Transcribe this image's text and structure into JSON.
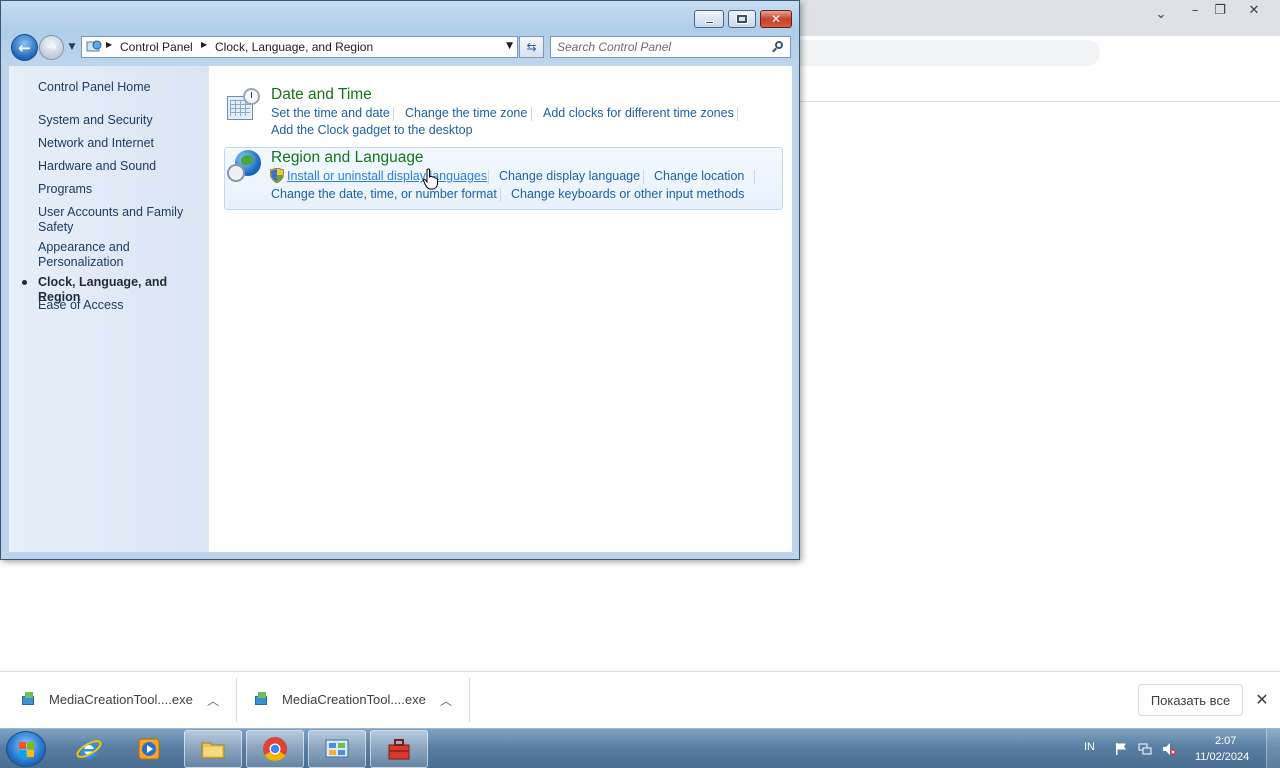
{
  "browser": {
    "toolbar_icons": [
      "share-icon",
      "star-icon",
      "side-panel-icon",
      "profile-icon",
      "menu-icon"
    ]
  },
  "window": {
    "title": "",
    "controls": {
      "minimize": "minimize",
      "maximize": "maximize",
      "close": "✕"
    }
  },
  "address": {
    "crumbs": [
      "Control Panel",
      "Clock, Language, and Region"
    ]
  },
  "search": {
    "placeholder": "Search Control Panel"
  },
  "sidebar": {
    "home": "Control Panel Home",
    "items": [
      {
        "label": "System and Security"
      },
      {
        "label": "Network and Internet"
      },
      {
        "label": "Hardware and Sound"
      },
      {
        "label": "Programs"
      },
      {
        "label": "User Accounts and Family Safety"
      },
      {
        "label": "Appearance and Personalization"
      },
      {
        "label": "Clock, Language, and Region",
        "current": true
      },
      {
        "label": "Ease of Access"
      }
    ]
  },
  "categories": [
    {
      "title": "Date and Time",
      "links": [
        "Set the time and date",
        "Change the time zone",
        "Add clocks for different time zones",
        "Add the Clock gadget to the desktop"
      ]
    },
    {
      "title": "Region and Language",
      "links": [
        "Install or uninstall display languages",
        "Change display language",
        "Change location",
        "Change the date, time, or number format",
        "Change keyboards or other input methods"
      ]
    }
  ],
  "downloads": {
    "items": [
      {
        "name": "MediaCreationTool....exe"
      },
      {
        "name": "MediaCreationTool....exe"
      }
    ],
    "show_all": "Показать все"
  },
  "taskbar": {
    "apps": [
      "internet-explorer",
      "media-player",
      "file-explorer",
      "chrome",
      "control-panel",
      "toolbox"
    ],
    "tray": {
      "language": "IN",
      "time": "2:07",
      "date": "11/02/2024"
    }
  },
  "colors": {
    "link": "#1f5fa5",
    "category_title": "#15731a",
    "sidebar_bg": "#dbe6f3"
  }
}
